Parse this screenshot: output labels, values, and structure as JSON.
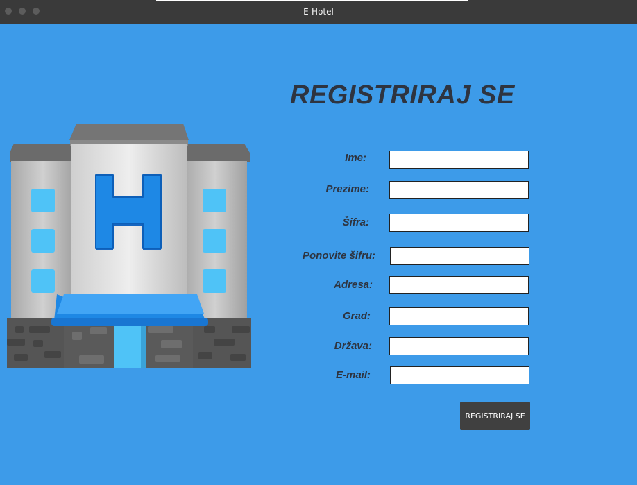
{
  "window": {
    "title": "E-Hotel"
  },
  "form": {
    "heading": "REGISTRIRAJ SE",
    "fields": [
      {
        "label": "Ime:",
        "value": "",
        "placeholder": ""
      },
      {
        "label": "Prezime:",
        "value": "",
        "placeholder": ""
      },
      {
        "label": "Šifra:",
        "value": "",
        "placeholder": ""
      },
      {
        "label": "Ponovite šifru:",
        "value": "",
        "placeholder": ""
      },
      {
        "label": "Adresa:",
        "value": "",
        "placeholder": ""
      },
      {
        "label": "Grad:",
        "value": "",
        "placeholder": ""
      },
      {
        "label": "Država:",
        "value": "",
        "placeholder": ""
      },
      {
        "label": "E-mail:",
        "value": "",
        "placeholder": ""
      }
    ],
    "submit_label": "REGISTRIRAJ SE"
  },
  "illustration": {
    "icon": "hotel-building-icon",
    "sign_letter": "H"
  },
  "colors": {
    "background": "#3d9be9",
    "titlebar": "#3a3a3a",
    "button": "#404040",
    "text": "#2e3440",
    "sign": "#1e88e5",
    "window_glass": "#4fc3f7"
  }
}
